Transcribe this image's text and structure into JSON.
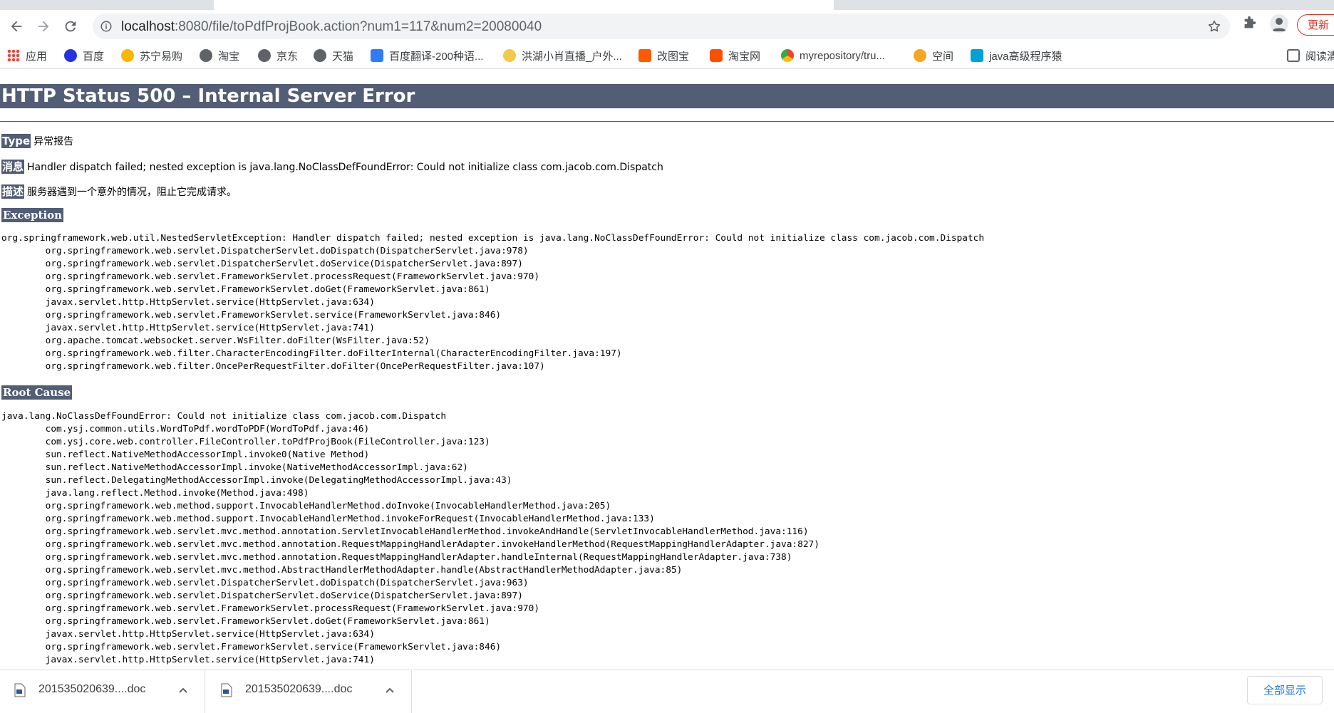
{
  "browser": {
    "url_host": "localhost",
    "url_rest": ":8080/file/toPdfProjBook.action?num1=117&num2=20080040",
    "update_label": "更新",
    "bookmarks": [
      {
        "label": "应用",
        "icon": "apps-grid-icon"
      },
      {
        "label": "百度",
        "icon": "baidu-paw-icon"
      },
      {
        "label": "苏宁易购",
        "icon": "suning-icon"
      },
      {
        "label": "淘宝",
        "icon": "globe-icon"
      },
      {
        "label": "京东",
        "icon": "globe-icon"
      },
      {
        "label": "天猫",
        "icon": "globe-icon"
      },
      {
        "label": "百度翻译-200种语...",
        "icon": "translate-icon"
      },
      {
        "label": "洪湖小肖直播_户外...",
        "icon": "bee-icon"
      },
      {
        "label": "改图宝",
        "icon": "orange-square-icon"
      },
      {
        "label": "淘宝网",
        "icon": "taobao-icon"
      },
      {
        "label": "myrepository/tru...",
        "icon": "chrome-icon"
      },
      {
        "label": "空间",
        "icon": "qzone-icon"
      },
      {
        "label": "java高级程序猿",
        "icon": "bilibili-tv-icon"
      },
      {
        "label": "阅读清",
        "icon": "reading-list-icon"
      }
    ]
  },
  "page": {
    "title": "HTTP Status 500 – Internal Server Error",
    "type_label": "Type",
    "type_value": "异常报告",
    "message_label": "消息",
    "message_value": "Handler dispatch failed; nested exception is java.lang.NoClassDefFoundError: Could not initialize class com.jacob.com.Dispatch",
    "description_label": "描述",
    "description_value": "服务器遇到一个意外的情况，阻止它完成请求。",
    "exception_heading": "Exception",
    "exception_trace": "org.springframework.web.util.NestedServletException: Handler dispatch failed; nested exception is java.lang.NoClassDefFoundError: Could not initialize class com.jacob.com.Dispatch\n\torg.springframework.web.servlet.DispatcherServlet.doDispatch(DispatcherServlet.java:978)\n\torg.springframework.web.servlet.DispatcherServlet.doService(DispatcherServlet.java:897)\n\torg.springframework.web.servlet.FrameworkServlet.processRequest(FrameworkServlet.java:970)\n\torg.springframework.web.servlet.FrameworkServlet.doGet(FrameworkServlet.java:861)\n\tjavax.servlet.http.HttpServlet.service(HttpServlet.java:634)\n\torg.springframework.web.servlet.FrameworkServlet.service(FrameworkServlet.java:846)\n\tjavax.servlet.http.HttpServlet.service(HttpServlet.java:741)\n\torg.apache.tomcat.websocket.server.WsFilter.doFilter(WsFilter.java:52)\n\torg.springframework.web.filter.CharacterEncodingFilter.doFilterInternal(CharacterEncodingFilter.java:197)\n\torg.springframework.web.filter.OncePerRequestFilter.doFilter(OncePerRequestFilter.java:107)",
    "root_cause_heading": "Root Cause",
    "root_cause_trace": "java.lang.NoClassDefFoundError: Could not initialize class com.jacob.com.Dispatch\n\tcom.ysj.common.utils.WordToPdf.wordToPDF(WordToPdf.java:46)\n\tcom.ysj.core.web.controller.FileController.toPdfProjBook(FileController.java:123)\n\tsun.reflect.NativeMethodAccessorImpl.invoke0(Native Method)\n\tsun.reflect.NativeMethodAccessorImpl.invoke(NativeMethodAccessorImpl.java:62)\n\tsun.reflect.DelegatingMethodAccessorImpl.invoke(DelegatingMethodAccessorImpl.java:43)\n\tjava.lang.reflect.Method.invoke(Method.java:498)\n\torg.springframework.web.method.support.InvocableHandlerMethod.doInvoke(InvocableHandlerMethod.java:205)\n\torg.springframework.web.method.support.InvocableHandlerMethod.invokeForRequest(InvocableHandlerMethod.java:133)\n\torg.springframework.web.servlet.mvc.method.annotation.ServletInvocableHandlerMethod.invokeAndHandle(ServletInvocableHandlerMethod.java:116)\n\torg.springframework.web.servlet.mvc.method.annotation.RequestMappingHandlerAdapter.invokeHandlerMethod(RequestMappingHandlerAdapter.java:827)\n\torg.springframework.web.servlet.mvc.method.annotation.RequestMappingHandlerAdapter.handleInternal(RequestMappingHandlerAdapter.java:738)\n\torg.springframework.web.servlet.mvc.method.AbstractHandlerMethodAdapter.handle(AbstractHandlerMethodAdapter.java:85)\n\torg.springframework.web.servlet.DispatcherServlet.doDispatch(DispatcherServlet.java:963)\n\torg.springframework.web.servlet.DispatcherServlet.doService(DispatcherServlet.java:897)\n\torg.springframework.web.servlet.FrameworkServlet.processRequest(FrameworkServlet.java:970)\n\torg.springframework.web.servlet.FrameworkServlet.doGet(FrameworkServlet.java:861)\n\tjavax.servlet.http.HttpServlet.service(HttpServlet.java:634)\n\torg.springframework.web.servlet.FrameworkServlet.service(FrameworkServlet.java:846)\n\tjavax.servlet.http.HttpServlet.service(HttpServlet.java:741)"
  },
  "downloads": {
    "items": [
      {
        "name": "201535020639....doc"
      },
      {
        "name": "201535020639....doc"
      }
    ],
    "show_all_label": "全部显示"
  },
  "colors": {
    "heading_bg": "#525d76",
    "update_red": "#d93025",
    "link_blue": "#1a73e8"
  }
}
